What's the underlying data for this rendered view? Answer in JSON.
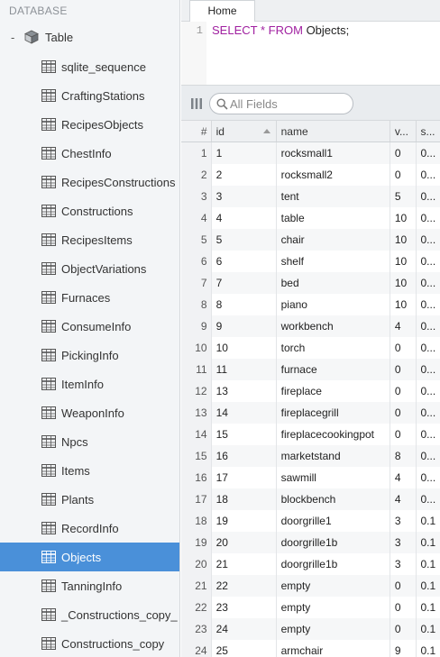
{
  "sidebar": {
    "header": "DATABASE",
    "root_toggle": "-",
    "root_label": "Table",
    "items": [
      {
        "label": "sqlite_sequence"
      },
      {
        "label": "CraftingStations"
      },
      {
        "label": "RecipesObjects"
      },
      {
        "label": "ChestInfo"
      },
      {
        "label": "RecipesConstructions"
      },
      {
        "label": "Constructions"
      },
      {
        "label": "RecipesItems"
      },
      {
        "label": "ObjectVariations"
      },
      {
        "label": "Furnaces"
      },
      {
        "label": "ConsumeInfo"
      },
      {
        "label": "PickingInfo"
      },
      {
        "label": "ItemInfo"
      },
      {
        "label": "WeaponInfo"
      },
      {
        "label": "Npcs"
      },
      {
        "label": "Items"
      },
      {
        "label": "Plants"
      },
      {
        "label": "RecordInfo"
      },
      {
        "label": "Objects",
        "selected": true
      },
      {
        "label": "TanningInfo"
      },
      {
        "label": "_Constructions_copy_"
      },
      {
        "label": "Constructions_copy"
      }
    ],
    "selected_color": "#4a90d9"
  },
  "tabs": [
    {
      "label": "Home"
    }
  ],
  "editor": {
    "line_number": "1",
    "keyword_select": "SELECT",
    "star": "*",
    "keyword_from": "FROM",
    "table": "Objects;"
  },
  "toolbar": {
    "columns_icon": "columns-icon",
    "search_icon": "search-icon",
    "search_placeholder": "All Fields"
  },
  "grid": {
    "headers": {
      "num": "#",
      "id": "id",
      "name": "name",
      "v": "v...",
      "s": "s..."
    },
    "rows": [
      {
        "num": "1",
        "id": "1",
        "name": "rocksmall1",
        "v": "0",
        "s": "0..."
      },
      {
        "num": "2",
        "id": "2",
        "name": "rocksmall2",
        "v": "0",
        "s": "0..."
      },
      {
        "num": "3",
        "id": "3",
        "name": "tent",
        "v": "5",
        "s": "0..."
      },
      {
        "num": "4",
        "id": "4",
        "name": "table",
        "v": "10",
        "s": "0..."
      },
      {
        "num": "5",
        "id": "5",
        "name": "chair",
        "v": "10",
        "s": "0..."
      },
      {
        "num": "6",
        "id": "6",
        "name": "shelf",
        "v": "10",
        "s": "0..."
      },
      {
        "num": "7",
        "id": "7",
        "name": "bed",
        "v": "10",
        "s": "0..."
      },
      {
        "num": "8",
        "id": "8",
        "name": "piano",
        "v": "10",
        "s": "0..."
      },
      {
        "num": "9",
        "id": "9",
        "name": "workbench",
        "v": "4",
        "s": "0..."
      },
      {
        "num": "10",
        "id": "10",
        "name": "torch",
        "v": "0",
        "s": "0..."
      },
      {
        "num": "11",
        "id": "11",
        "name": "furnace",
        "v": "0",
        "s": "0..."
      },
      {
        "num": "12",
        "id": "13",
        "name": "fireplace",
        "v": "0",
        "s": "0..."
      },
      {
        "num": "13",
        "id": "14",
        "name": "fireplacegrill",
        "v": "0",
        "s": "0..."
      },
      {
        "num": "14",
        "id": "15",
        "name": "fireplacecookingpot",
        "v": "0",
        "s": "0..."
      },
      {
        "num": "15",
        "id": "16",
        "name": "marketstand",
        "v": "8",
        "s": "0..."
      },
      {
        "num": "16",
        "id": "17",
        "name": "sawmill",
        "v": "4",
        "s": "0..."
      },
      {
        "num": "17",
        "id": "18",
        "name": "blockbench",
        "v": "4",
        "s": "0..."
      },
      {
        "num": "18",
        "id": "19",
        "name": "doorgrille1",
        "v": "3",
        "s": "0.1"
      },
      {
        "num": "19",
        "id": "20",
        "name": "doorgrille1b",
        "v": "3",
        "s": "0.1"
      },
      {
        "num": "20",
        "id": "21",
        "name": "doorgrille1b",
        "v": "3",
        "s": "0.1"
      },
      {
        "num": "21",
        "id": "22",
        "name": "empty",
        "v": "0",
        "s": "0.1"
      },
      {
        "num": "22",
        "id": "23",
        "name": "empty",
        "v": "0",
        "s": "0.1"
      },
      {
        "num": "23",
        "id": "24",
        "name": "empty",
        "v": "0",
        "s": "0.1"
      },
      {
        "num": "24",
        "id": "25",
        "name": "armchair",
        "v": "9",
        "s": "0.1"
      }
    ]
  }
}
